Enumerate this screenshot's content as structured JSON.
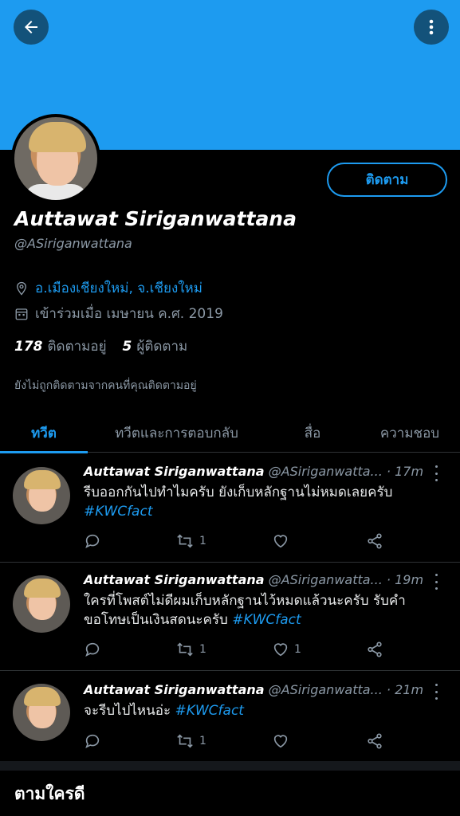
{
  "header": {
    "back_icon": "arrow-left-icon",
    "more_icon": "more-vertical-icon",
    "banner_color": "#1d9bf0"
  },
  "profile": {
    "follow_label": "ติดตาม",
    "name": "Auttawat Siriganwattana",
    "handle": "@ASiriganwattana",
    "location": "อ.เมืองเชียงใหม่, จ.เชียงใหม่",
    "joined": "เข้าร่วมเมื่อ เมษายน ค.ศ. 2019",
    "following_count": "178",
    "following_label": "ติดตามอยู่",
    "followers_count": "5",
    "followers_label": "ผู้ติดตาม",
    "note": "ยังไม่ถูกติดตามจากคนที่คุณติดตามอยู่"
  },
  "tabs": [
    {
      "label": "ทวีต"
    },
    {
      "label": "ทวีตและการตอบกลับ"
    },
    {
      "label": "สื่อ"
    },
    {
      "label": "ความชอบ"
    }
  ],
  "tweets": [
    {
      "name": "Auttawat Siriganwattana",
      "handle": "@ASiriganwatta...",
      "time": "· 17m",
      "text": "รีบออกกันไปทำไมครับ ยังเก็บหลักฐานไม่หมดเลยครับ",
      "hashtag": "#KWCfact",
      "retweets": "1",
      "likes": ""
    },
    {
      "name": "Auttawat Siriganwattana",
      "handle": "@ASiriganwatta...",
      "time": "· 19m",
      "text": "ใครที่โพสต์ไม่ดีผมเก็บหลักฐานไว้หมดแล้วนะครับ รับคำขอโทษเป็นเงินสดนะครับ",
      "hashtag": "#KWCfact",
      "retweets": "1",
      "likes": "1"
    },
    {
      "name": "Auttawat Siriganwattana",
      "handle": "@ASiriganwatta...",
      "time": "· 21m",
      "text": "จะรีบไปไหนอ่ะ",
      "hashtag": "#KWCfact",
      "retweets": "1",
      "likes": ""
    }
  ],
  "who_to_follow": {
    "title": "ตามใครดี"
  },
  "colors": {
    "accent": "#1d9bf0",
    "background": "#000000",
    "muted": "#8b98a5"
  }
}
